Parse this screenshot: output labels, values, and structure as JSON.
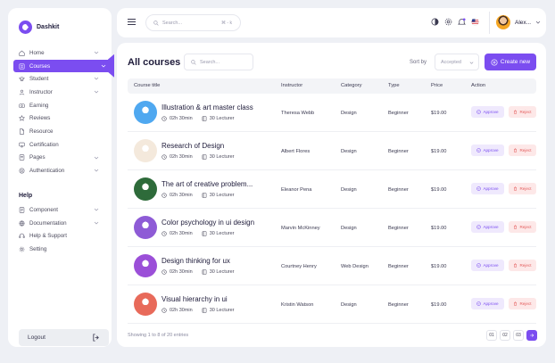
{
  "app": {
    "name": "Dashkit"
  },
  "sidebar": {
    "items": [
      {
        "label": "Home",
        "icon": "home-icon",
        "chevron": true
      },
      {
        "label": "Courses",
        "icon": "courses-icon",
        "chevron": true,
        "active": true
      },
      {
        "label": "Student",
        "icon": "student-icon",
        "chevron": true
      },
      {
        "label": "Instructor",
        "icon": "instructor-icon",
        "chevron": true
      },
      {
        "label": "Earning",
        "icon": "earning-icon",
        "chevron": false
      },
      {
        "label": "Reviews",
        "icon": "star-icon",
        "chevron": false
      },
      {
        "label": "Resource",
        "icon": "resource-icon",
        "chevron": false
      },
      {
        "label": "Certification",
        "icon": "certificate-icon",
        "chevron": false
      },
      {
        "label": "Pages",
        "icon": "pages-icon",
        "chevron": true
      },
      {
        "label": "Authentication",
        "icon": "auth-icon",
        "chevron": true
      }
    ],
    "help_title": "Help",
    "help_items": [
      {
        "label": "Component",
        "icon": "component-icon",
        "chevron": true
      },
      {
        "label": "Documentation",
        "icon": "documentation-icon",
        "chevron": true
      },
      {
        "label": "Help & Support",
        "icon": "headset-icon",
        "chevron": false
      },
      {
        "label": "Setting",
        "icon": "gear-icon",
        "chevron": false
      }
    ],
    "logout_label": "Logout"
  },
  "topbar": {
    "search_placeholder": "Search...",
    "search_shortcut": "⌘ - k",
    "user_name": "Alex..."
  },
  "main": {
    "title": "All courses",
    "search_placeholder": "Search...",
    "sort_label": "Sort by",
    "sort_value": "Accepted",
    "create_label": "Create new",
    "columns": [
      "Course title",
      "Instructor",
      "Category",
      "Type",
      "Price",
      "Action"
    ],
    "approve_label": "Approve",
    "reject_label": "Reject",
    "courses": [
      {
        "title": "Illustration & art master class",
        "duration": "02h 30min",
        "lectures": "30 Lecturer",
        "instructor": "Theresa Webb",
        "category": "Design",
        "type": "Beginner",
        "price": "$19.00",
        "thumb": "#4fa8f0"
      },
      {
        "title": "Research of Design",
        "duration": "02h 30min",
        "lectures": "30 Lecturer",
        "instructor": "Albert Flores",
        "category": "Design",
        "type": "Beginner",
        "price": "$19.00",
        "thumb": "#f4e9dc"
      },
      {
        "title": "The art of creative problem...",
        "duration": "02h 30min",
        "lectures": "30 Lecturer",
        "instructor": "Eleanor Pena",
        "category": "Design",
        "type": "Beginner",
        "price": "$19.00",
        "thumb": "#2e6b3a"
      },
      {
        "title": "Color psychology in ui design",
        "duration": "02h 30min",
        "lectures": "30 Lecturer",
        "instructor": "Marvin McKinney",
        "category": "Design",
        "type": "Beginner",
        "price": "$19.00",
        "thumb": "#8e5bd6"
      },
      {
        "title": "Design thinking for ux",
        "duration": "02h 30min",
        "lectures": "30 Lecturer",
        "instructor": "Courtney Henry",
        "category": "Web Design",
        "type": "Beginner",
        "price": "$19.00",
        "thumb": "#9b4fd8"
      },
      {
        "title": "Visual hierarchy in ui",
        "duration": "02h 30min",
        "lectures": "30 Lecturer",
        "instructor": "Kristin Watson",
        "category": "Design",
        "type": "Beginner",
        "price": "$19.00",
        "thumb": "#e86a5a"
      }
    ],
    "footer_info": "Showing 1 to 8 of 20 entries",
    "pages": [
      "01",
      "02",
      "03"
    ]
  },
  "colors": {
    "accent": "#7b4df0",
    "reject": "#e35b5b"
  }
}
